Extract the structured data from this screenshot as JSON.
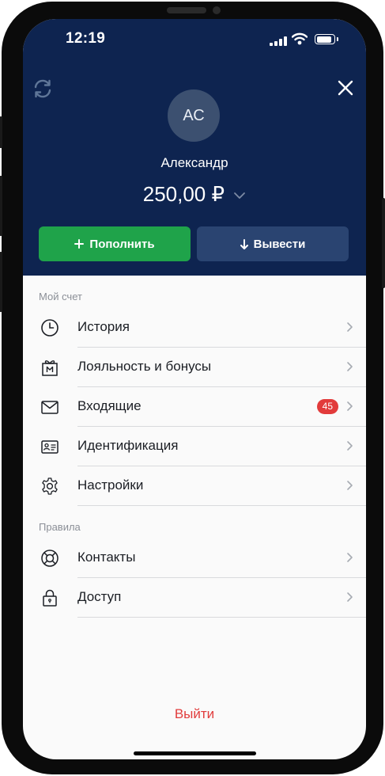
{
  "status_bar": {
    "time": "12:19"
  },
  "profile": {
    "initials": "АС",
    "name": "Александр",
    "balance": "250,00 ₽"
  },
  "actions": {
    "deposit_label": "Пополнить",
    "withdraw_label": "Вывести"
  },
  "sections": {
    "account": {
      "title": "Мой счет",
      "items": [
        {
          "label": "История",
          "icon": "clock-icon"
        },
        {
          "label": "Лояльность и бонусы",
          "icon": "gift-icon"
        },
        {
          "label": "Входящие",
          "icon": "envelope-icon",
          "badge": "45"
        },
        {
          "label": "Идентификация",
          "icon": "id-card-icon"
        },
        {
          "label": "Настройки",
          "icon": "gear-icon"
        }
      ]
    },
    "rules": {
      "title": "Правила",
      "items": [
        {
          "label": "Контакты",
          "icon": "lifebuoy-icon"
        },
        {
          "label": "Доступ",
          "icon": "lock-icon"
        }
      ]
    }
  },
  "logout_label": "Выйти",
  "colors": {
    "header_bg": "#0e2450",
    "deposit_button": "#1fa34a",
    "withdraw_button": "#2a4471",
    "badge": "#e23b3b",
    "logout_text": "#e13c3c"
  }
}
